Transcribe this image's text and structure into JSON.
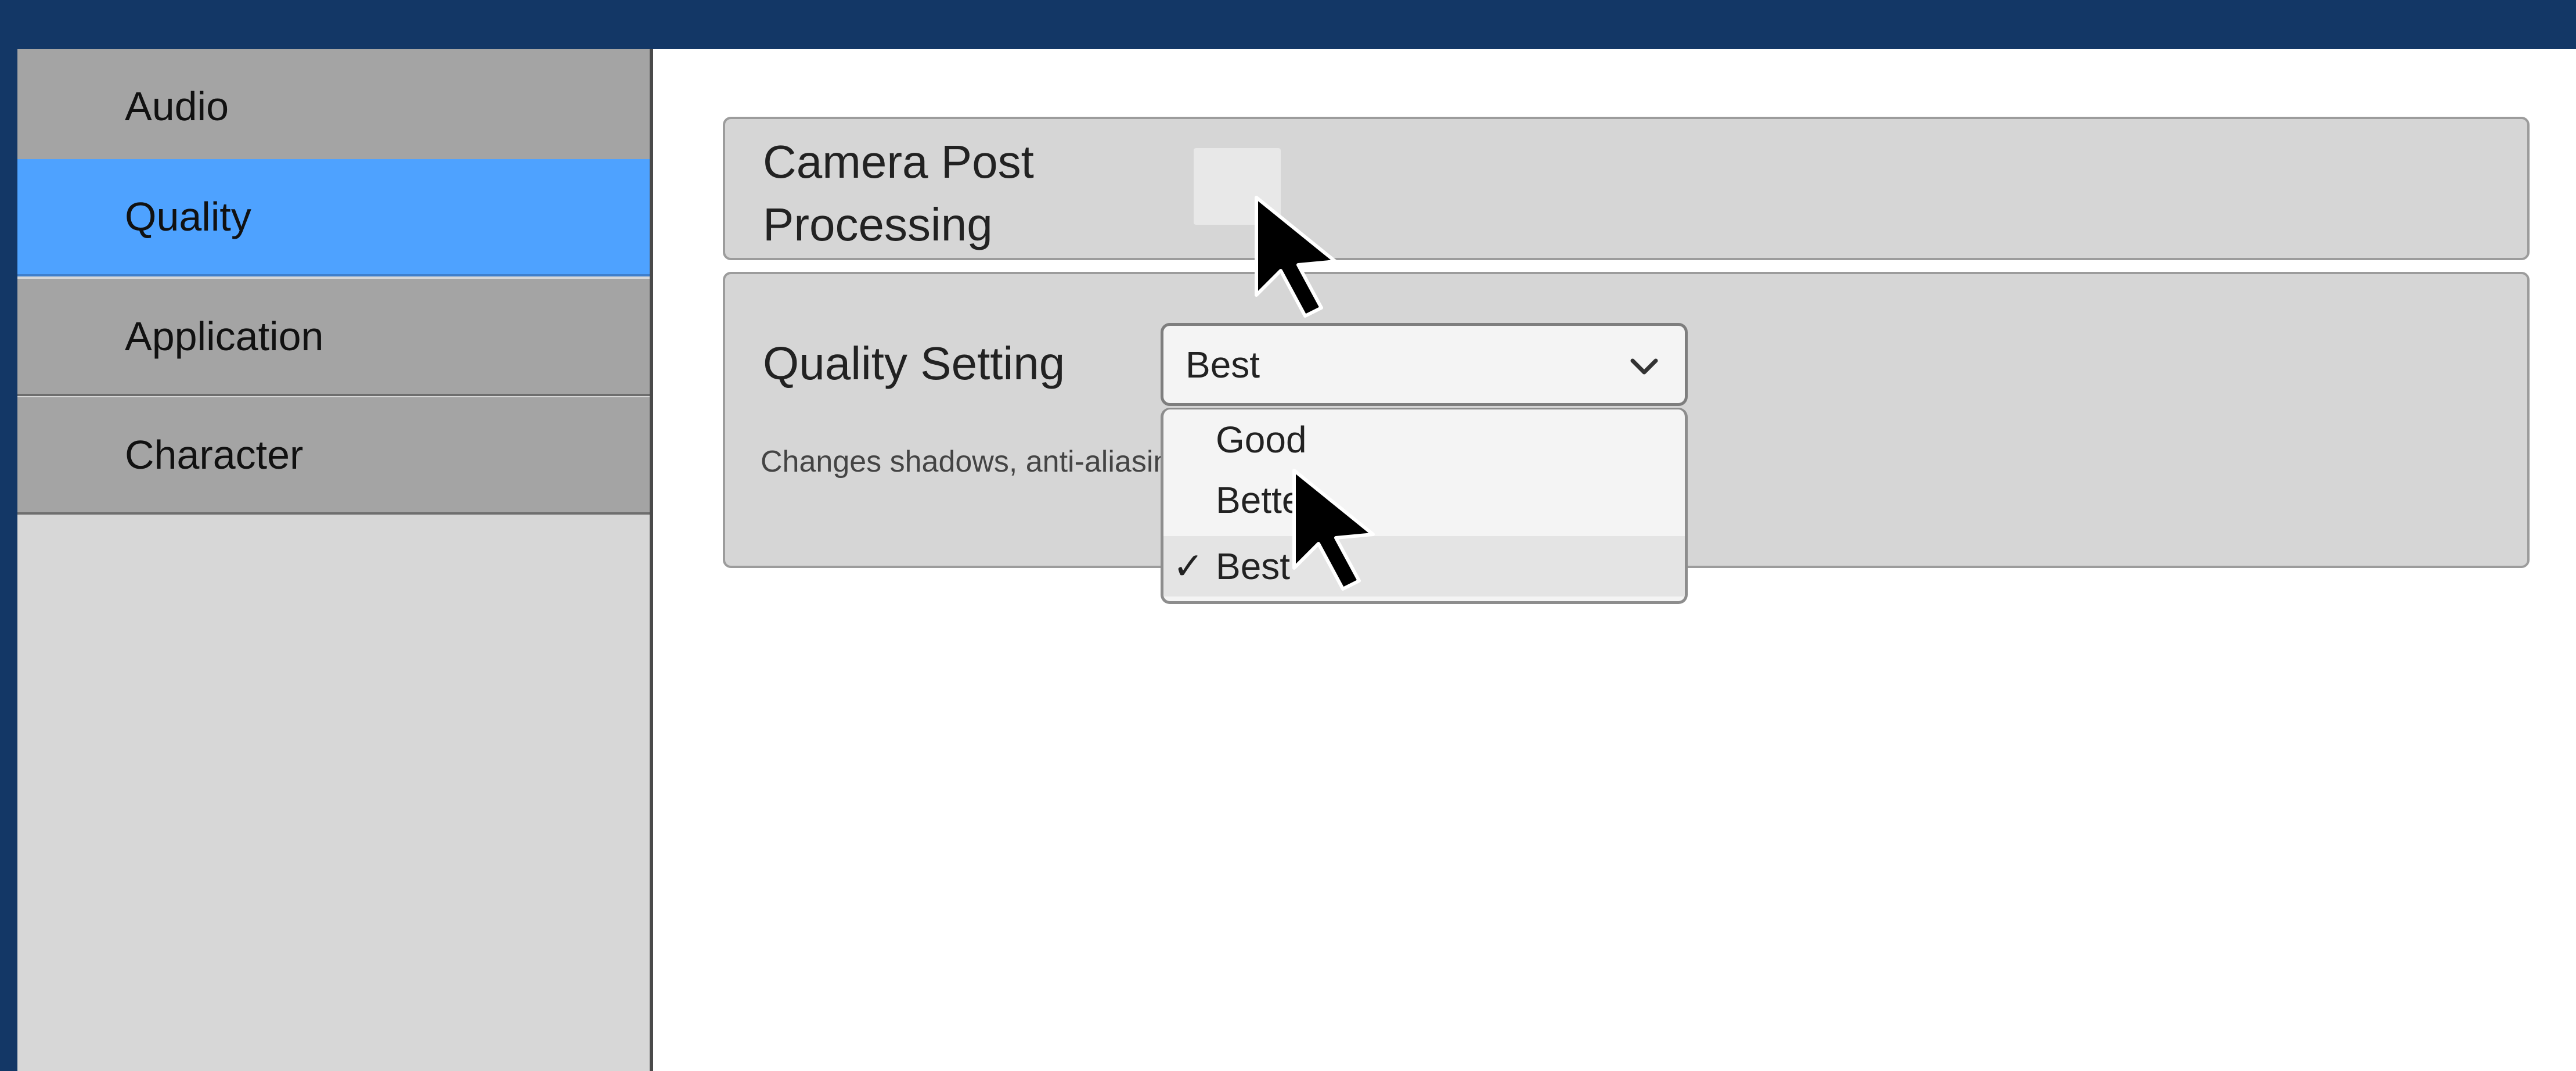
{
  "sidebar": {
    "items": [
      {
        "label": "Audio"
      },
      {
        "label": "Quality"
      },
      {
        "label": "Application"
      },
      {
        "label": "Character"
      }
    ],
    "active_index": 1
  },
  "camera_post_processing": {
    "title_line1": "Camera Post",
    "title_line2": "Processing",
    "checked": false
  },
  "quality_setting": {
    "title": "Quality Setting",
    "selected_value": "Best",
    "description": "Changes shadows, anti-aliasin",
    "options": [
      "Good",
      "Better",
      "Best"
    ],
    "check_mark": "✓"
  },
  "colors": {
    "frame": "#133766",
    "sidebar_active": "#4ea2ff",
    "sidebar_item": "#a4a4a4",
    "panel": "#d6d6d6"
  }
}
